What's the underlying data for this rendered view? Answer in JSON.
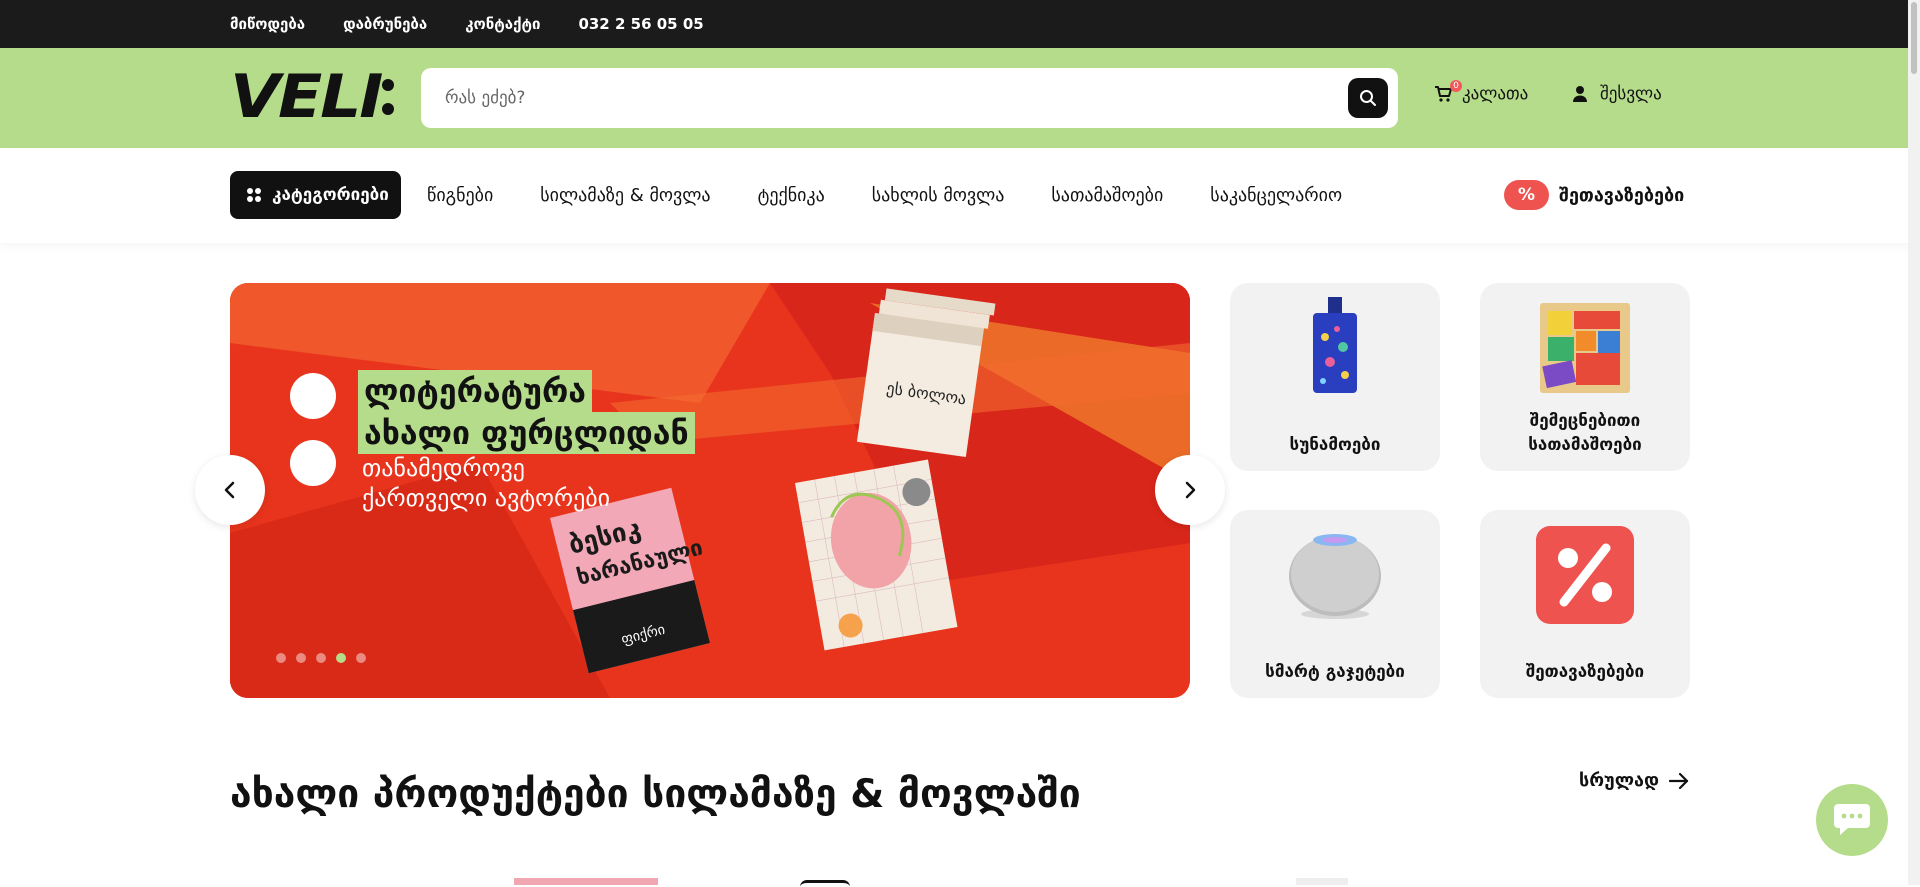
{
  "topbar": {
    "links": [
      "მიწოდება",
      "დაბრუნება",
      "კონტაქტი"
    ],
    "phone": "032 2 56 05 05"
  },
  "header": {
    "logo_text": "VELI",
    "search_placeholder": "რას ეძებ?",
    "cart_label": "კალათა",
    "cart_count": "0",
    "login_label": "შესვლა"
  },
  "nav": {
    "categories_label": "კატეგორიები",
    "links": [
      "წიგნები",
      "სილამაზე & მოვლა",
      "ტექნიკა",
      "სახლის მოვლა",
      "სათამაშოები",
      "საკანცელარიო"
    ],
    "offers_badge": "%",
    "offers_label": "შეთავაზებები"
  },
  "hero": {
    "headline_line1": "ლიტერატურა",
    "headline_line2": "ახალი ფურცლიდან",
    "sub_line1": "თანამედროვე",
    "sub_line2": "ქართველი ავტორები",
    "slide_count": 5,
    "active_slide": 4,
    "colors": {
      "background": "#e8341c",
      "highlight": "#b5dc8a"
    }
  },
  "tiles": [
    {
      "label": "სუნამოები",
      "icon": "perfume-bottle-icon"
    },
    {
      "label": "შემეცნებითი სათამაშოები",
      "icon": "wooden-puzzle-icon"
    },
    {
      "label": "სმარტ გაჯეტები",
      "icon": "smart-speaker-icon"
    },
    {
      "label": "შეთავაზებები",
      "icon": "percent-badge-icon"
    }
  ],
  "section": {
    "title": "ახალი პროდუქტები სილამაზე & მოვლაში",
    "see_all": "სრულად"
  },
  "colors": {
    "topbar": "#1b1b1b",
    "header": "#b5dc8a",
    "accent_red": "#ef5350",
    "tile_bg": "#f2f2f3"
  }
}
